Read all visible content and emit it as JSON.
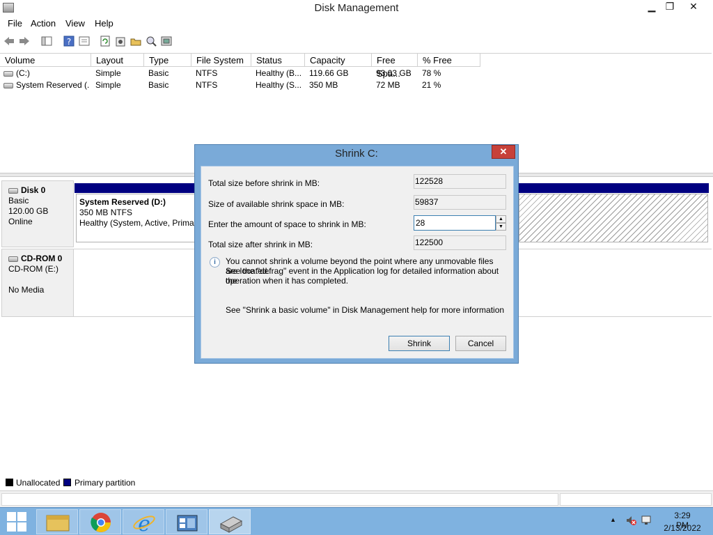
{
  "window": {
    "title": "Disk Management",
    "min": "▁",
    "max": "❐",
    "close": "✕"
  },
  "menu": [
    "File",
    "Action",
    "View",
    "Help"
  ],
  "toolbar_icons": [
    "back-icon",
    "forward-icon",
    "console-tree-icon",
    "help-icon",
    "properties-icon",
    "refresh-icon",
    "settings-icon",
    "open-icon",
    "search-icon",
    "disk-settings-icon"
  ],
  "volume_list": {
    "columns": [
      "Volume",
      "Layout",
      "Type",
      "File System",
      "Status",
      "Capacity",
      "Free Spa...",
      "% Free"
    ],
    "rows": [
      [
        "(C:)",
        "Simple",
        "Basic",
        "NTFS",
        "Healthy (B...",
        "119.66 GB",
        "93.03 GB",
        "78 %"
      ],
      [
        "System Reserved (...",
        "Simple",
        "Basic",
        "NTFS",
        "Healthy (S...",
        "350 MB",
        "72 MB",
        "21 %"
      ]
    ]
  },
  "disks": {
    "disk0": {
      "name": "Disk 0",
      "type": "Basic",
      "size": "120.00 GB",
      "state": "Online",
      "partition": {
        "name": "System Reserved  (D:)",
        "size": "350 MB NTFS",
        "status": "Healthy (System, Active, Primar"
      }
    },
    "cdrom0": {
      "name": "CD-ROM 0",
      "drive": "CD-ROM (E:)",
      "media": "No Media"
    }
  },
  "legend": [
    {
      "label": "Unallocated",
      "color": "#000000"
    },
    {
      "label": "Primary partition",
      "color": "#000080"
    }
  ],
  "dialog": {
    "title": "Shrink C:",
    "close": "✕",
    "total_before_label": "Total size before shrink in MB:",
    "total_before_value": "122528",
    "available_label": "Size of available shrink space in MB:",
    "available_value": "59837",
    "amount_label": "Enter the amount of space to shrink in MB:",
    "amount_value": "28",
    "after_label": "Total size after shrink in MB:",
    "after_value": "122500",
    "info_line1": "You cannot shrink a volume beyond the point where any unmovable files are located.",
    "info_line2": "See the \"defrag\" event in the Application log for detailed information about the",
    "info_line3": "operation when it has completed.",
    "help_text": "See \"Shrink a basic volume\" in Disk Management help for more information",
    "shrink_button": "Shrink",
    "cancel_button": "Cancel"
  },
  "taskbar": {
    "apps": [
      "file-explorer-icon",
      "chrome-icon",
      "internet-explorer-icon",
      "server-manager-icon",
      "disk-management-icon"
    ],
    "time": "3:29 PM",
    "date": "2/13/2022"
  },
  "colors": {
    "primary_partition": "#000080",
    "taskbar": "#7fb2e0",
    "dialog_frame": "#7aaad8"
  }
}
